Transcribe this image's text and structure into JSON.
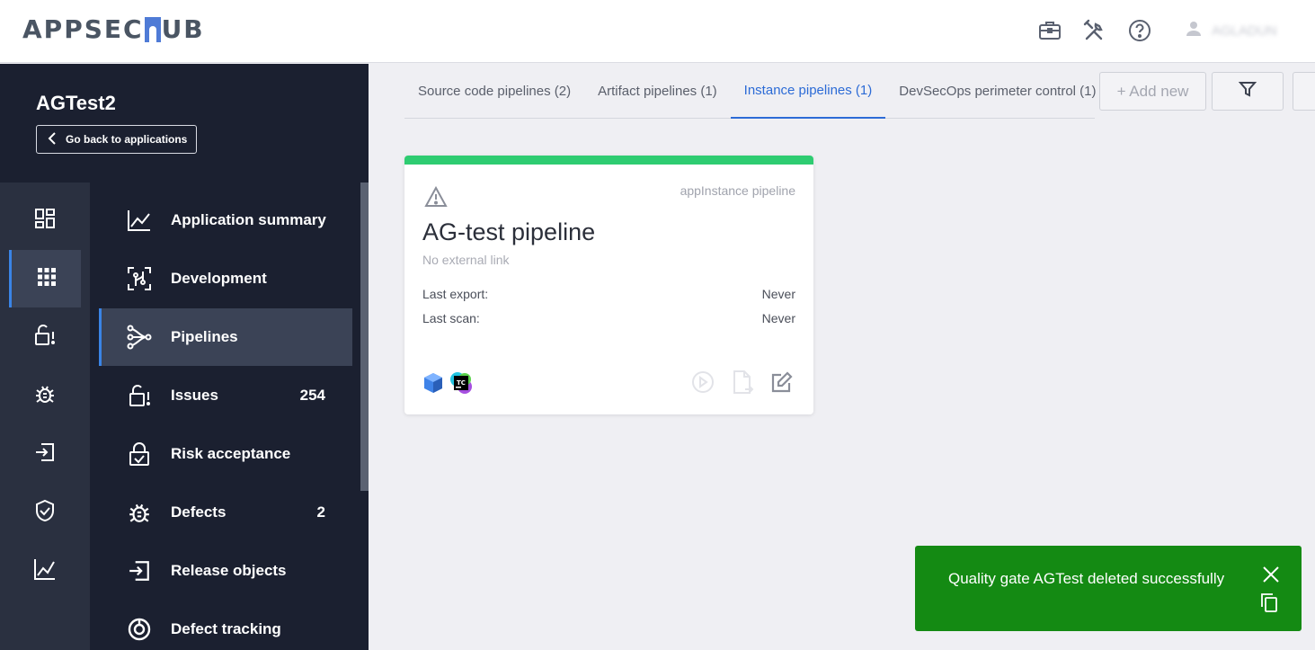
{
  "header": {
    "logo_text_left": "APPSEC",
    "logo_text_right": "UB",
    "icons": [
      "briefcase-icon",
      "tools-icon",
      "help-icon",
      "user-icon"
    ],
    "user_name": "AGLADUN"
  },
  "app": {
    "title": "AGTest2",
    "back_label": "Go back to applications"
  },
  "rail": {
    "items": [
      "dashboard-icon",
      "apps-grid-icon",
      "lock-alert-icon",
      "bug-icon",
      "sign-in-icon",
      "shield-icon",
      "chart-icon"
    ],
    "active_index": 1
  },
  "menu": {
    "items": [
      {
        "label": "Application summary",
        "icon": "chart-line-icon",
        "count": ""
      },
      {
        "label": "Development",
        "icon": "code-scan-icon",
        "count": ""
      },
      {
        "label": "Pipelines",
        "icon": "pipeline-icon",
        "count": ""
      },
      {
        "label": "Issues",
        "icon": "lock-alert-icon",
        "count": "254"
      },
      {
        "label": "Risk acceptance",
        "icon": "lock-check-icon",
        "count": ""
      },
      {
        "label": "Defects",
        "icon": "bug-icon",
        "count": "2"
      },
      {
        "label": "Release objects",
        "icon": "sign-in-icon",
        "count": ""
      },
      {
        "label": "Defect tracking",
        "icon": "target-icon",
        "count": ""
      }
    ],
    "active_index": 2
  },
  "tabs": {
    "items": [
      "Source code pipelines (2)",
      "Artifact pipelines (1)",
      "Instance pipelines (1)",
      "DevSecOps perimeter control (1)"
    ],
    "active_index": 2,
    "add_new_label": "+ Add new"
  },
  "card": {
    "type_label": "appInstance pipeline",
    "title": "AG-test pipeline",
    "link_text": "No external link",
    "rows": [
      {
        "label": "Last export:",
        "value": "Never"
      },
      {
        "label": "Last scan:",
        "value": "Never"
      }
    ],
    "status_color": "#2ecc71"
  },
  "toast": {
    "message": "Quality gate AGTest deleted successfully",
    "color": "#148a13"
  }
}
